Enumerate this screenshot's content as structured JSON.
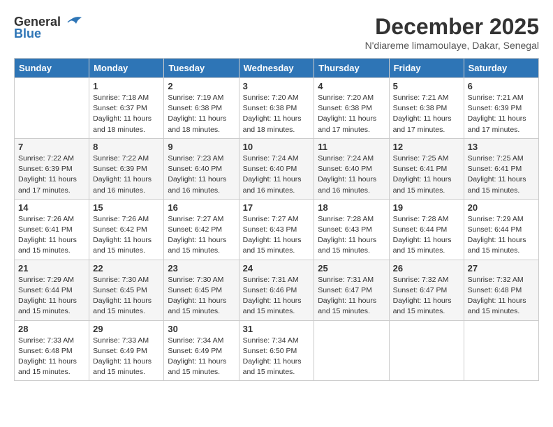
{
  "logo": {
    "general": "General",
    "blue": "Blue"
  },
  "title": "December 2025",
  "location": "N'diareme limamoulaye, Dakar, Senegal",
  "days_of_week": [
    "Sunday",
    "Monday",
    "Tuesday",
    "Wednesday",
    "Thursday",
    "Friday",
    "Saturday"
  ],
  "weeks": [
    [
      {
        "day": "",
        "sunrise": "",
        "sunset": "",
        "daylight": ""
      },
      {
        "day": "1",
        "sunrise": "Sunrise: 7:18 AM",
        "sunset": "Sunset: 6:37 PM",
        "daylight": "Daylight: 11 hours and 18 minutes."
      },
      {
        "day": "2",
        "sunrise": "Sunrise: 7:19 AM",
        "sunset": "Sunset: 6:38 PM",
        "daylight": "Daylight: 11 hours and 18 minutes."
      },
      {
        "day": "3",
        "sunrise": "Sunrise: 7:20 AM",
        "sunset": "Sunset: 6:38 PM",
        "daylight": "Daylight: 11 hours and 18 minutes."
      },
      {
        "day": "4",
        "sunrise": "Sunrise: 7:20 AM",
        "sunset": "Sunset: 6:38 PM",
        "daylight": "Daylight: 11 hours and 17 minutes."
      },
      {
        "day": "5",
        "sunrise": "Sunrise: 7:21 AM",
        "sunset": "Sunset: 6:38 PM",
        "daylight": "Daylight: 11 hours and 17 minutes."
      },
      {
        "day": "6",
        "sunrise": "Sunrise: 7:21 AM",
        "sunset": "Sunset: 6:39 PM",
        "daylight": "Daylight: 11 hours and 17 minutes."
      }
    ],
    [
      {
        "day": "7",
        "sunrise": "Sunrise: 7:22 AM",
        "sunset": "Sunset: 6:39 PM",
        "daylight": "Daylight: 11 hours and 17 minutes."
      },
      {
        "day": "8",
        "sunrise": "Sunrise: 7:22 AM",
        "sunset": "Sunset: 6:39 PM",
        "daylight": "Daylight: 11 hours and 16 minutes."
      },
      {
        "day": "9",
        "sunrise": "Sunrise: 7:23 AM",
        "sunset": "Sunset: 6:40 PM",
        "daylight": "Daylight: 11 hours and 16 minutes."
      },
      {
        "day": "10",
        "sunrise": "Sunrise: 7:24 AM",
        "sunset": "Sunset: 6:40 PM",
        "daylight": "Daylight: 11 hours and 16 minutes."
      },
      {
        "day": "11",
        "sunrise": "Sunrise: 7:24 AM",
        "sunset": "Sunset: 6:40 PM",
        "daylight": "Daylight: 11 hours and 16 minutes."
      },
      {
        "day": "12",
        "sunrise": "Sunrise: 7:25 AM",
        "sunset": "Sunset: 6:41 PM",
        "daylight": "Daylight: 11 hours and 15 minutes."
      },
      {
        "day": "13",
        "sunrise": "Sunrise: 7:25 AM",
        "sunset": "Sunset: 6:41 PM",
        "daylight": "Daylight: 11 hours and 15 minutes."
      }
    ],
    [
      {
        "day": "14",
        "sunrise": "Sunrise: 7:26 AM",
        "sunset": "Sunset: 6:41 PM",
        "daylight": "Daylight: 11 hours and 15 minutes."
      },
      {
        "day": "15",
        "sunrise": "Sunrise: 7:26 AM",
        "sunset": "Sunset: 6:42 PM",
        "daylight": "Daylight: 11 hours and 15 minutes."
      },
      {
        "day": "16",
        "sunrise": "Sunrise: 7:27 AM",
        "sunset": "Sunset: 6:42 PM",
        "daylight": "Daylight: 11 hours and 15 minutes."
      },
      {
        "day": "17",
        "sunrise": "Sunrise: 7:27 AM",
        "sunset": "Sunset: 6:43 PM",
        "daylight": "Daylight: 11 hours and 15 minutes."
      },
      {
        "day": "18",
        "sunrise": "Sunrise: 7:28 AM",
        "sunset": "Sunset: 6:43 PM",
        "daylight": "Daylight: 11 hours and 15 minutes."
      },
      {
        "day": "19",
        "sunrise": "Sunrise: 7:28 AM",
        "sunset": "Sunset: 6:44 PM",
        "daylight": "Daylight: 11 hours and 15 minutes."
      },
      {
        "day": "20",
        "sunrise": "Sunrise: 7:29 AM",
        "sunset": "Sunset: 6:44 PM",
        "daylight": "Daylight: 11 hours and 15 minutes."
      }
    ],
    [
      {
        "day": "21",
        "sunrise": "Sunrise: 7:29 AM",
        "sunset": "Sunset: 6:44 PM",
        "daylight": "Daylight: 11 hours and 15 minutes."
      },
      {
        "day": "22",
        "sunrise": "Sunrise: 7:30 AM",
        "sunset": "Sunset: 6:45 PM",
        "daylight": "Daylight: 11 hours and 15 minutes."
      },
      {
        "day": "23",
        "sunrise": "Sunrise: 7:30 AM",
        "sunset": "Sunset: 6:45 PM",
        "daylight": "Daylight: 11 hours and 15 minutes."
      },
      {
        "day": "24",
        "sunrise": "Sunrise: 7:31 AM",
        "sunset": "Sunset: 6:46 PM",
        "daylight": "Daylight: 11 hours and 15 minutes."
      },
      {
        "day": "25",
        "sunrise": "Sunrise: 7:31 AM",
        "sunset": "Sunset: 6:47 PM",
        "daylight": "Daylight: 11 hours and 15 minutes."
      },
      {
        "day": "26",
        "sunrise": "Sunrise: 7:32 AM",
        "sunset": "Sunset: 6:47 PM",
        "daylight": "Daylight: 11 hours and 15 minutes."
      },
      {
        "day": "27",
        "sunrise": "Sunrise: 7:32 AM",
        "sunset": "Sunset: 6:48 PM",
        "daylight": "Daylight: 11 hours and 15 minutes."
      }
    ],
    [
      {
        "day": "28",
        "sunrise": "Sunrise: 7:33 AM",
        "sunset": "Sunset: 6:48 PM",
        "daylight": "Daylight: 11 hours and 15 minutes."
      },
      {
        "day": "29",
        "sunrise": "Sunrise: 7:33 AM",
        "sunset": "Sunset: 6:49 PM",
        "daylight": "Daylight: 11 hours and 15 minutes."
      },
      {
        "day": "30",
        "sunrise": "Sunrise: 7:34 AM",
        "sunset": "Sunset: 6:49 PM",
        "daylight": "Daylight: 11 hours and 15 minutes."
      },
      {
        "day": "31",
        "sunrise": "Sunrise: 7:34 AM",
        "sunset": "Sunset: 6:50 PM",
        "daylight": "Daylight: 11 hours and 15 minutes."
      },
      {
        "day": "",
        "sunrise": "",
        "sunset": "",
        "daylight": ""
      },
      {
        "day": "",
        "sunrise": "",
        "sunset": "",
        "daylight": ""
      },
      {
        "day": "",
        "sunrise": "",
        "sunset": "",
        "daylight": ""
      }
    ]
  ]
}
